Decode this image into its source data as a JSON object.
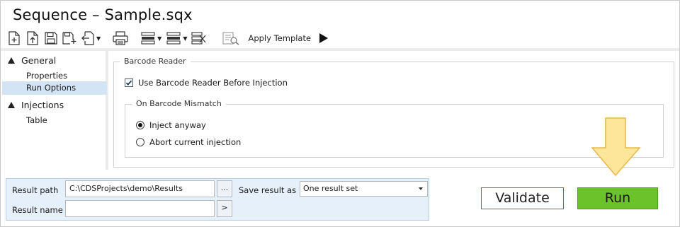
{
  "window": {
    "title": "Sequence – Sample.sqx"
  },
  "toolbar": {
    "icons": [
      "new-document-icon",
      "upload-icon",
      "save-icon",
      "save-add-icon",
      "import-icon",
      "print-icon",
      "insert-rows-icon",
      "delete-rows-icon",
      "clear-table-icon",
      "template-icon",
      "play-icon"
    ],
    "apply_template_label": "Apply Template"
  },
  "sidebar": {
    "groups": [
      {
        "label": "General",
        "items": [
          "Properties",
          "Run Options"
        ]
      },
      {
        "label": "Injections",
        "items": [
          "Table"
        ]
      }
    ],
    "selected_item": "Run Options"
  },
  "barcode": {
    "section_title": "Barcode Reader",
    "use_reader_label": "Use Barcode Reader Before Injection",
    "use_reader_checked": true,
    "mismatch": {
      "title": "On Barcode Mismatch",
      "options": [
        "Inject anyway",
        "Abort current injection"
      ],
      "selected": "Inject anyway"
    }
  },
  "result": {
    "path_label": "Result path",
    "path_value": "C:\\CDSProjects\\demo\\Results",
    "browse_label": "...",
    "save_as_label": "Save result as",
    "save_as_value": "One result set",
    "name_label": "Result name",
    "name_value": "",
    "name_button_label": ">"
  },
  "actions": {
    "validate_label": "Validate",
    "run_label": "Run"
  },
  "colors": {
    "run_button": "#6cc22a",
    "validate_border": "#2a7bb5",
    "selection": "#d3e4f5",
    "bottom_panel": "#e6f0fa",
    "arrow_fill": "#fde59a",
    "arrow_stroke": "#e6b94a"
  }
}
